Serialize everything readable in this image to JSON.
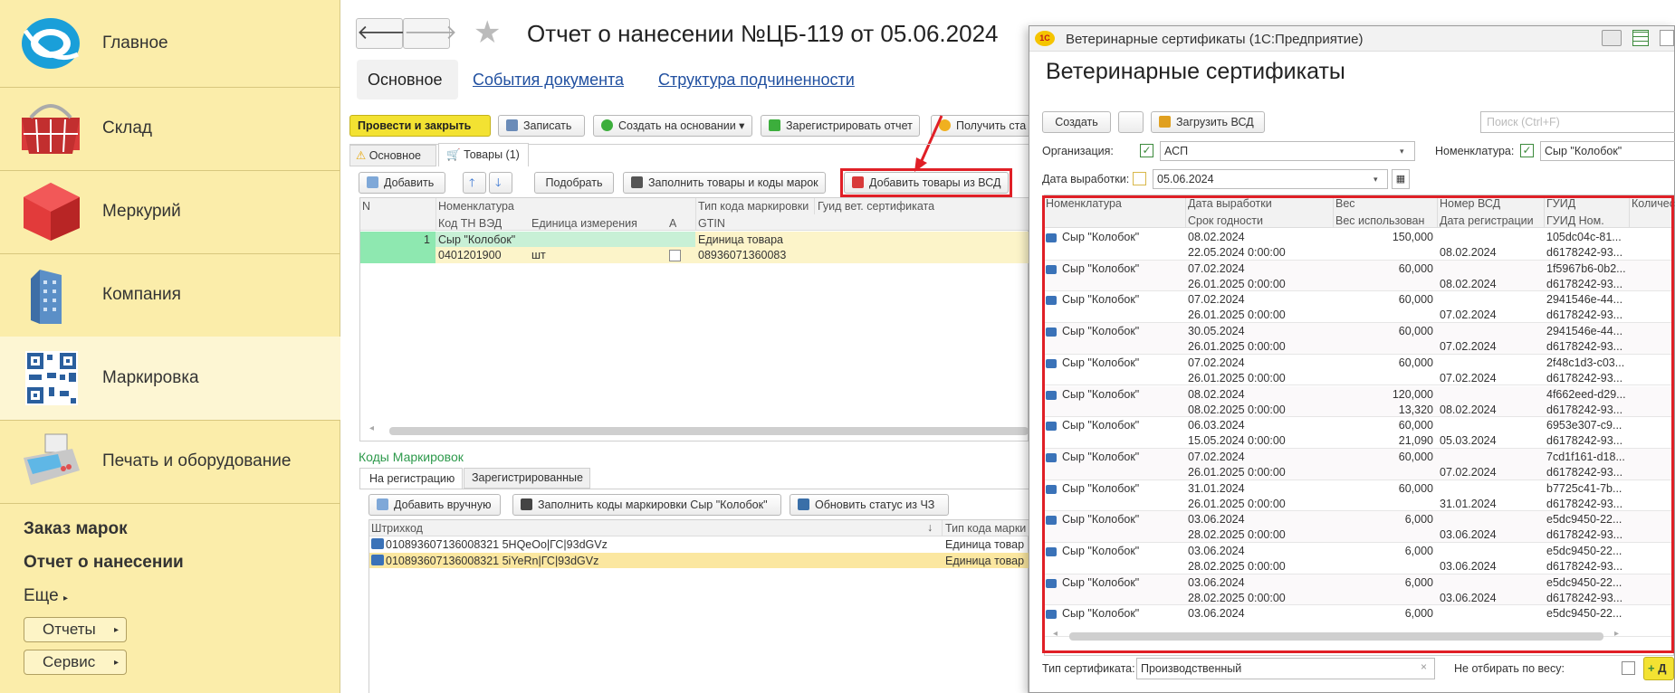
{
  "sidebar": {
    "sections": [
      "Главное",
      "Склад",
      "Меркурий",
      "Компания",
      "Маркировка",
      "Печать и оборудование"
    ],
    "links": [
      "Заказ марок",
      "Отчет о нанесении"
    ],
    "more": "Еще",
    "pills": [
      "Отчеты",
      "Сервис"
    ]
  },
  "doc": {
    "title": "Отчет о нанесении №ЦБ-119 от 05.06.2024",
    "tabs": [
      "Основное",
      "События документа",
      "Структура подчиненности"
    ],
    "toolbar": [
      "Провести и закрыть",
      "Записать",
      "Создать на основании",
      "Зарегистрировать отчет",
      "Получить ста"
    ],
    "subtabs": [
      "Основное",
      "Товары (1)"
    ],
    "goods_toolbar": [
      "Добавить",
      "Подобрать",
      "Заполнить товары и коды марок",
      "Добавить товары из ВСД"
    ],
    "grid_head": {
      "n": "N",
      "nom": "Номенклатура",
      "type": "Тип кода маркировки",
      "guid": "Гуид вет. сертификата",
      "tnved": "Код ТН ВЭД",
      "unit": "Единица измерения",
      "a": "А",
      "gtin": "GTIN"
    },
    "row": {
      "n": "1",
      "nom": "Сыр \"Колобок\"",
      "type": "Единица товара",
      "tnved": "0401201900",
      "unit": "шт",
      "gtin": "08936071360083"
    },
    "codes_title": "Коды Маркировок",
    "codes_tabs": [
      "На регистрацию",
      "Зарегистрированные"
    ],
    "codes_toolbar": [
      "Добавить вручную",
      "Заполнить коды маркировки Сыр \"Колобок\"",
      "Обновить статус из ЧЗ"
    ],
    "codes_head": {
      "barcode": "Штрихкод",
      "sort": "↓",
      "type": "Тип кода марки"
    },
    "codes": [
      {
        "code": "010893607136008321 5HQeOo|ГС|93dGVz",
        "type": "Единица товар"
      },
      {
        "code": "010893607136008321 5iYeRn|ГС|93dGVz",
        "type": "Единица товар"
      }
    ]
  },
  "vet": {
    "window_title": "Ветеринарные сертификаты  (1С:Предприятие)",
    "heading": "Ветеринарные сертификаты",
    "buttons": {
      "create": "Создать",
      "load": "Загрузить ВСД"
    },
    "search_placeholder": "Поиск (Ctrl+F)",
    "filters": {
      "org_label": "Организация:",
      "org_value": "АСП",
      "nom_label": "Номенклатура:",
      "nom_value": "Сыр \"Колобок\"",
      "date_label": "Дата выработки:",
      "date_value": "05.06.2024"
    },
    "head1": [
      "Номенклатура",
      "Дата выработки",
      "Вес",
      "Номер ВСД",
      "ГУИД",
      "Количес"
    ],
    "head2": [
      "Срок годности",
      "Вес использован",
      "Дата регистрации",
      "ГУИД Ном."
    ],
    "rows": [
      {
        "nom": "Сыр \"Колобок\"",
        "date": "08.02.2024",
        "exp": "22.05.2024 0:00:00",
        "w": "150,000",
        "wu": "",
        "vsd": "",
        "reg": "08.02.2024",
        "guid": "105dc04c-81...",
        "guidn": "d6178242-93..."
      },
      {
        "nom": "Сыр \"Колобок\"",
        "date": "07.02.2024",
        "exp": "26.01.2025 0:00:00",
        "w": "60,000",
        "wu": "",
        "vsd": "",
        "reg": "08.02.2024",
        "guid": "1f5967b6-0b2...",
        "guidn": "d6178242-93..."
      },
      {
        "nom": "Сыр \"Колобок\"",
        "date": "07.02.2024",
        "exp": "26.01.2025 0:00:00",
        "w": "60,000",
        "wu": "",
        "vsd": "",
        "reg": "07.02.2024",
        "guid": "2941546e-44...",
        "guidn": "d6178242-93..."
      },
      {
        "nom": "Сыр \"Колобок\"",
        "date": "30.05.2024",
        "exp": "26.01.2025 0:00:00",
        "w": "60,000",
        "wu": "",
        "vsd": "",
        "reg": "07.02.2024",
        "guid": "2941546e-44...",
        "guidn": "d6178242-93..."
      },
      {
        "nom": "Сыр \"Колобок\"",
        "date": "07.02.2024",
        "exp": "26.01.2025 0:00:00",
        "w": "60,000",
        "wu": "",
        "vsd": "",
        "reg": "07.02.2024",
        "guid": "2f48c1d3-c03...",
        "guidn": "d6178242-93..."
      },
      {
        "nom": "Сыр \"Колобок\"",
        "date": "08.02.2024",
        "exp": "08.02.2025 0:00:00",
        "w": "120,000",
        "wu": "13,320",
        "vsd": "",
        "reg": "08.02.2024",
        "guid": "4f662eed-d29...",
        "guidn": "d6178242-93..."
      },
      {
        "nom": "Сыр \"Колобок\"",
        "date": "06.03.2024",
        "exp": "15.05.2024 0:00:00",
        "w": "60,000",
        "wu": "21,090",
        "vsd": "",
        "reg": "05.03.2024",
        "guid": "6953e307-c9...",
        "guidn": "d6178242-93..."
      },
      {
        "nom": "Сыр \"Колобок\"",
        "date": "07.02.2024",
        "exp": "26.01.2025 0:00:00",
        "w": "60,000",
        "wu": "",
        "vsd": "",
        "reg": "07.02.2024",
        "guid": "7cd1f161-d18...",
        "guidn": "d6178242-93..."
      },
      {
        "nom": "Сыр \"Колобок\"",
        "date": "31.01.2024",
        "exp": "26.01.2025 0:00:00",
        "w": "60,000",
        "wu": "",
        "vsd": "",
        "reg": "31.01.2024",
        "guid": "b7725c41-7b...",
        "guidn": "d6178242-93..."
      },
      {
        "nom": "Сыр \"Колобок\"",
        "date": "03.06.2024",
        "exp": "28.02.2025 0:00:00",
        "w": "6,000",
        "wu": "",
        "vsd": "",
        "reg": "03.06.2024",
        "guid": "e5dc9450-22...",
        "guidn": "d6178242-93..."
      },
      {
        "nom": "Сыр \"Колобок\"",
        "date": "03.06.2024",
        "exp": "28.02.2025 0:00:00",
        "w": "6,000",
        "wu": "",
        "vsd": "",
        "reg": "03.06.2024",
        "guid": "e5dc9450-22...",
        "guidn": "d6178242-93..."
      },
      {
        "nom": "Сыр \"Колобок\"",
        "date": "03.06.2024",
        "exp": "28.02.2025 0:00:00",
        "w": "6,000",
        "wu": "",
        "vsd": "",
        "reg": "03.06.2024",
        "guid": "e5dc9450-22...",
        "guidn": "d6178242-93..."
      },
      {
        "nom": "Сыр \"Колобок\"",
        "date": "03.06.2024",
        "exp": "",
        "w": "6,000",
        "wu": "",
        "vsd": "",
        "reg": "",
        "guid": "e5dc9450-22...",
        "guidn": ""
      }
    ],
    "bottom": {
      "type_label": "Тип сертификата:",
      "type_value": "Производственный",
      "noweight_label": "Не отбирать по весу:",
      "ok": "Д"
    }
  }
}
